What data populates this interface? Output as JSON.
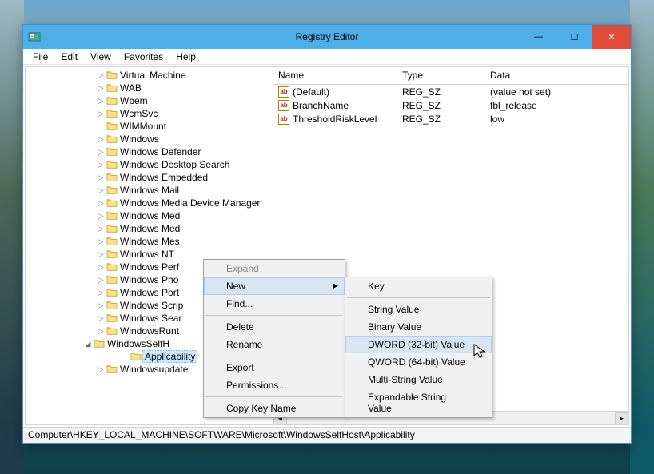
{
  "window": {
    "title": "Registry Editor"
  },
  "menubar": [
    "File",
    "Edit",
    "View",
    "Favorites",
    "Help"
  ],
  "tree": {
    "items": [
      {
        "expand": "▷",
        "label": "Virtual Machine"
      },
      {
        "expand": "▷",
        "label": "WAB"
      },
      {
        "expand": "▷",
        "label": "Wbem"
      },
      {
        "expand": "▷",
        "label": "WcmSvc"
      },
      {
        "expand": "",
        "label": "WIMMount"
      },
      {
        "expand": "▷",
        "label": "Windows"
      },
      {
        "expand": "▷",
        "label": "Windows Defender"
      },
      {
        "expand": "▷",
        "label": "Windows Desktop Search"
      },
      {
        "expand": "▷",
        "label": "Windows Embedded"
      },
      {
        "expand": "▷",
        "label": "Windows Mail"
      },
      {
        "expand": "▷",
        "label": "Windows Media Device Manager"
      },
      {
        "expand": "▷",
        "label": "Windows Med"
      },
      {
        "expand": "▷",
        "label": "Windows Med"
      },
      {
        "expand": "▷",
        "label": "Windows Mes"
      },
      {
        "expand": "▷",
        "label": "Windows NT"
      },
      {
        "expand": "▷",
        "label": "Windows Perf"
      },
      {
        "expand": "▷",
        "label": "Windows Pho"
      },
      {
        "expand": "▷",
        "label": "Windows Port"
      },
      {
        "expand": "▷",
        "label": "Windows Scrip"
      },
      {
        "expand": "▷",
        "label": "Windows Sear"
      },
      {
        "expand": "▷",
        "label": "WindowsRunt"
      },
      {
        "expand": "◢",
        "label": "WindowsSelfH",
        "container": true
      },
      {
        "expand": "",
        "label": "Applicability",
        "child": true,
        "selected": true
      },
      {
        "expand": "▷",
        "label": "Windowsupdate"
      }
    ]
  },
  "list": {
    "columns": {
      "name": "Name",
      "type": "Type",
      "data": "Data"
    },
    "rows": [
      {
        "name": "(Default)",
        "type": "REG_SZ",
        "data": "(value not set)"
      },
      {
        "name": "BranchName",
        "type": "REG_SZ",
        "data": "fbl_release"
      },
      {
        "name": "ThresholdRiskLevel",
        "type": "REG_SZ",
        "data": "low"
      }
    ]
  },
  "context_menu": {
    "items": [
      {
        "label": "Expand",
        "disabled": true
      },
      {
        "label": "New",
        "submenu": true,
        "highlight": true
      },
      {
        "label": "Find..."
      },
      {
        "sep": true
      },
      {
        "label": "Delete"
      },
      {
        "label": "Rename"
      },
      {
        "sep": true
      },
      {
        "label": "Export"
      },
      {
        "label": "Permissions..."
      },
      {
        "sep": true
      },
      {
        "label": "Copy Key Name"
      }
    ]
  },
  "submenu": {
    "items": [
      {
        "label": "Key"
      },
      {
        "sep": true
      },
      {
        "label": "String Value"
      },
      {
        "label": "Binary Value"
      },
      {
        "label": "DWORD (32-bit) Value",
        "highlight": true
      },
      {
        "label": "QWORD (64-bit) Value"
      },
      {
        "label": "Multi-String Value"
      },
      {
        "label": "Expandable String Value"
      }
    ]
  },
  "statusbar": "Computer\\HKEY_LOCAL_MACHINE\\SOFTWARE\\Microsoft\\WindowsSelfHost\\Applicability"
}
